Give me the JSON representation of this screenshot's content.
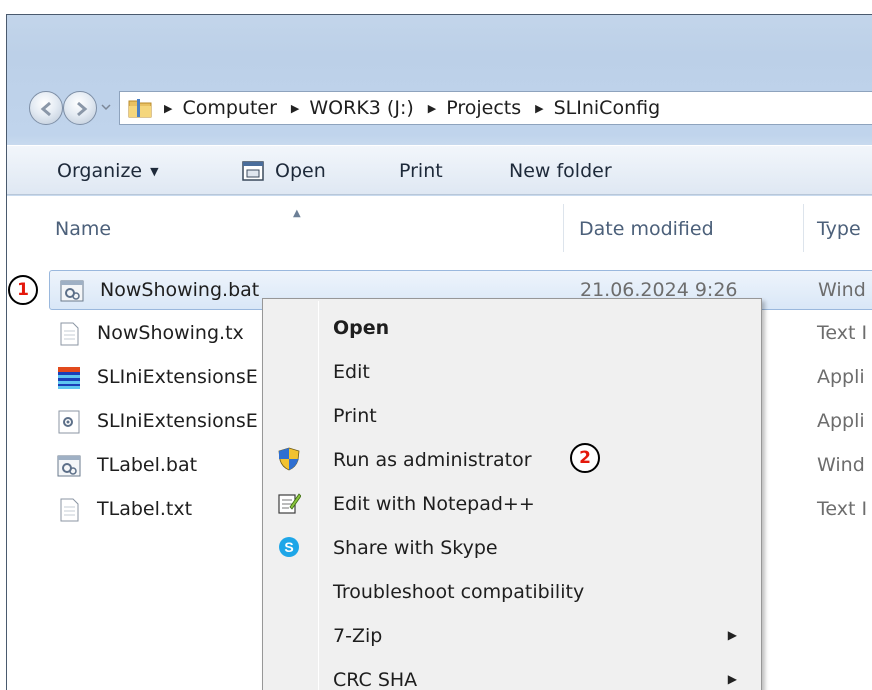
{
  "breadcrumb": {
    "items": [
      "Computer",
      "WORK3 (J:)",
      "Projects",
      "SLIniConfig"
    ]
  },
  "toolbar": {
    "organize_label": "Organize",
    "open_label": "Open",
    "print_label": "Print",
    "new_folder_label": "New folder"
  },
  "columns": {
    "name": "Name",
    "date_modified": "Date modified",
    "type": "Type"
  },
  "files": [
    {
      "name": "NowShowing.bat",
      "date": "21.06.2024 9:26",
      "type": "Wind",
      "icon": "batch-file-icon",
      "selected": true
    },
    {
      "name": "NowShowing.tx",
      "date": "",
      "type": "Text I",
      "icon": "text-file-icon",
      "selected": false
    },
    {
      "name": "SLIniExtensionsE",
      "date": "",
      "type": "Appli",
      "icon": "application-icon",
      "selected": false
    },
    {
      "name": "SLIniExtensionsE",
      "date": "",
      "type": "Appli",
      "icon": "gear-file-icon",
      "selected": false
    },
    {
      "name": "TLabel.bat",
      "date": "",
      "type": "Wind",
      "icon": "batch-file-icon",
      "selected": false
    },
    {
      "name": "TLabel.txt",
      "date": "",
      "type": "Text I",
      "icon": "text-file-icon",
      "selected": false
    }
  ],
  "context_menu": {
    "items": [
      {
        "label": "Open",
        "default": true,
        "icon": "",
        "submenu": false
      },
      {
        "label": "Edit",
        "default": false,
        "icon": "",
        "submenu": false
      },
      {
        "label": "Print",
        "default": false,
        "icon": "",
        "submenu": false
      },
      {
        "label": "Run as administrator",
        "default": false,
        "icon": "uac-shield-icon",
        "submenu": false
      },
      {
        "label": "Edit with Notepad++",
        "default": false,
        "icon": "notepad-plus-plus-icon",
        "submenu": false
      },
      {
        "label": "Share with Skype",
        "default": false,
        "icon": "skype-icon",
        "submenu": false
      },
      {
        "label": "Troubleshoot compatibility",
        "default": false,
        "icon": "",
        "submenu": false
      },
      {
        "label": "7-Zip",
        "default": false,
        "icon": "",
        "submenu": true
      },
      {
        "label": "CRC SHA",
        "default": false,
        "icon": "",
        "submenu": true
      }
    ]
  },
  "callouts": {
    "one": "1",
    "two": "2"
  },
  "colors": {
    "selection_border": "#9ab8dd",
    "callout_text": "#e4180b",
    "menu_bg": "#f0f0f0"
  }
}
